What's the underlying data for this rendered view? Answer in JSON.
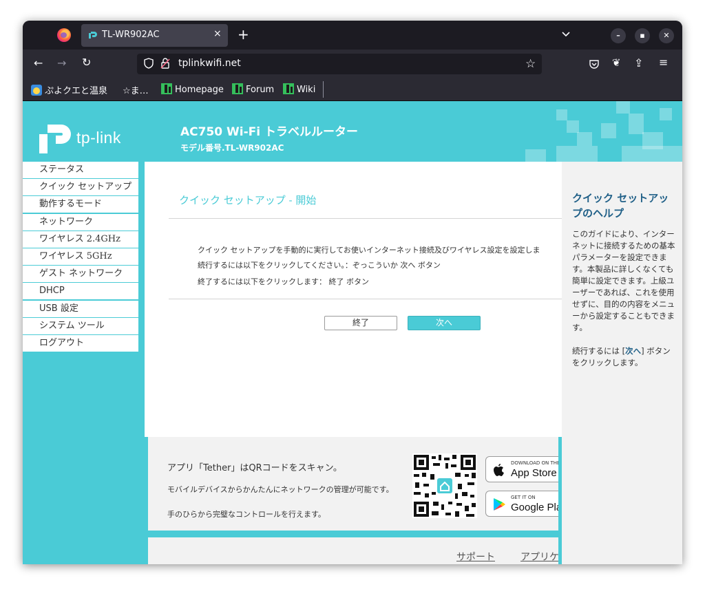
{
  "browser": {
    "tab_title": "TL-WR902AC",
    "tab_close": "×",
    "new_tab": "+",
    "url": "tplinkwifi.net",
    "bookmarks": [
      {
        "label": "ぷよクエと温泉"
      },
      {
        "label": "☆ま…"
      },
      {
        "label": "Homepage"
      },
      {
        "label": "Forum"
      },
      {
        "label": "Wiki"
      }
    ],
    "colors": {
      "accent": "#4acbd6",
      "toolbar": "#2b2a33",
      "tabstrip": "#1c1b22"
    }
  },
  "header": {
    "logo_text": "tp-link",
    "model_title": "AC750 Wi-Fi トラベルルーター",
    "model_number": "モデル番号.TL-WR902AC"
  },
  "sidebar": {
    "items": [
      {
        "label": "ステータス"
      },
      {
        "label": "クイック セットアップ"
      },
      {
        "label": "動作するモード"
      },
      {
        "label": "ネットワーク"
      },
      {
        "label": "ワイヤレス 2.4GHz"
      },
      {
        "label": "ワイヤレス 5GHz"
      },
      {
        "label": "ゲスト ネットワーク"
      },
      {
        "label": "DHCP"
      },
      {
        "label": "USB 設定"
      },
      {
        "label": "システム ツール"
      },
      {
        "label": "ログアウト"
      }
    ]
  },
  "main": {
    "title": "クイック セットアップ - 開始",
    "line1": "クイック セットアップを手動的に実行してお使いインターネット接続及びワイヤレス設定を設定しま",
    "line2": "続行するには以下をクリックしてください。：ぞっこういか 次へ ボタン",
    "line3": "終了するには以下をクリックします： 終了 ボタン",
    "btn_end": "終了",
    "btn_next": "次へ"
  },
  "help": {
    "title": "クイック セットアップのヘルプ",
    "body": "このガイドにより、インターネットに接続するための基本パラメーターを設定できます。本製品に詳しくなくても簡単に設定できます。上級ユーザーであれば、これを使用せずに、目的の内容をメニューから設定することもできます。",
    "body2_pre": "続行するには [",
    "body2_link": "次へ",
    "body2_post": "] ボタンをクリックします。"
  },
  "tether": {
    "title": "アプリ「Tether」はQRコードをスキャン。",
    "desc1": "モバイルデバイスからかんたんにネットワークの管理が可能です。",
    "desc2": "手のひらから完璧なコントロールを行えます。",
    "appstore_small": "DOWNLOAD ON THE",
    "appstore_big": "App Store",
    "google_small": "GET IT ON",
    "google_big": "Google Play"
  },
  "footer": {
    "support": "サポート",
    "app": "アプリケ"
  }
}
